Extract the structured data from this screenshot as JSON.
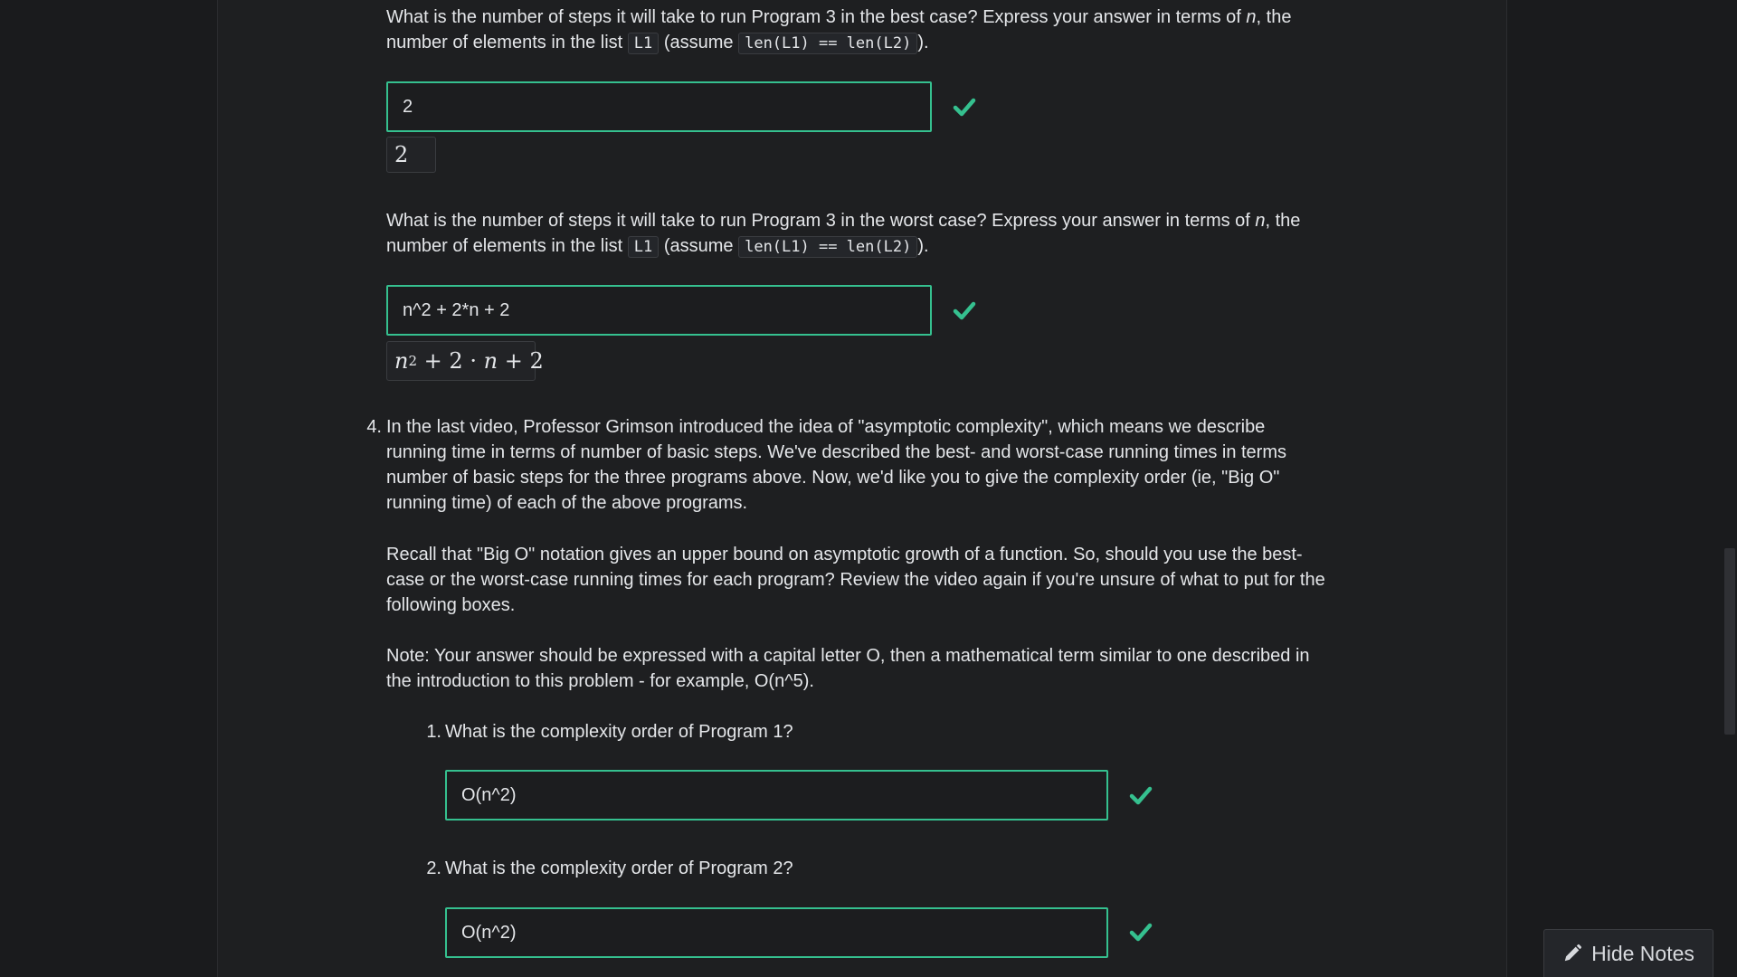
{
  "q3_best": {
    "line1_a": "What is the number of steps it will take to run Program 3 in the best case? Express your answer in terms of ",
    "var_n": "n",
    "line1_b": ", the",
    "line2_a": "number of elements in the list ",
    "code_l1": "L1",
    "line2_b": " (assume ",
    "code_len": "len(L1) == len(L2)",
    "line2_c": ").",
    "input_value": "2",
    "preview": "2",
    "status": "correct"
  },
  "q3_worst": {
    "line1_a": "What is the number of steps it will take to run Program 3 in the worst case? Express your answer in terms of ",
    "var_n": "n",
    "line1_b": ", the",
    "line2_a": "number of elements in the list ",
    "code_l1": "L1",
    "line2_b": " (assume ",
    "code_len": "len(L1) == len(L2)",
    "line2_c": ").",
    "input_value": "n^2 + 2*n + 2",
    "preview": {
      "n1": "n",
      "exp": "2",
      "op1": "+",
      "two": "2",
      "dot": "·",
      "n2": "n",
      "op2": "+",
      "two2": "2"
    },
    "status": "correct"
  },
  "q4": {
    "number": "4.",
    "para1": [
      "In the last video, Professor Grimson introduced the idea of \"asymptotic complexity\", which means we describe",
      "running time in terms of number of basic steps. We've described the best- and worst-case running times in terms",
      "number of basic steps for the three programs above. Now, we'd like you to give the complexity order (ie, \"Big O\"",
      "running time) of each of the above programs."
    ],
    "para2": [
      "Recall that \"Big O\" notation gives an upper bound on asymptotic growth of a function. So, should you use the best-",
      "case or the worst-case running times for each program? Review the video again if you're unsure of what to put for the",
      "following boxes."
    ],
    "para3": [
      "Note: Your answer should be expressed with a capital letter O, then a mathematical term similar to one described in",
      "the introduction to this problem - for example, O(n^5)."
    ],
    "subquestions": [
      {
        "number": "1.",
        "question": "What is the complexity order of Program 1?",
        "input_value": "O(n^2)",
        "status": "correct"
      },
      {
        "number": "2.",
        "question": "What is the complexity order of Program 2?",
        "input_value": "O(n^2)",
        "status": "correct"
      }
    ]
  },
  "hide_notes": {
    "label": "Hide Notes",
    "icon": "pencil-icon"
  },
  "colors": {
    "accent_correct": "#35c08f",
    "background": "#1e1f21"
  }
}
